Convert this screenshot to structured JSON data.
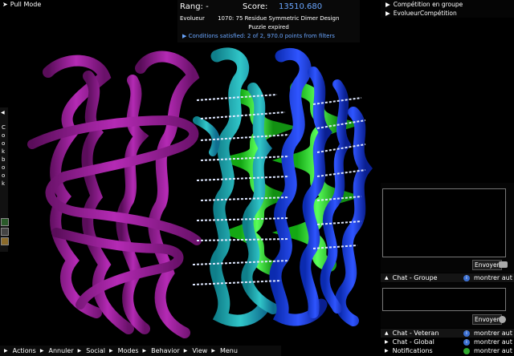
{
  "pull_mode": {
    "label": "Pull Mode"
  },
  "score_panel": {
    "rank_label": "Rang: -",
    "score_label": "Score:",
    "score_value": "13510.680",
    "player": "Evolueur",
    "puzzle_title": "1070: 75 Residue Symmetric Dimer Design",
    "status": "Puzzle expired",
    "conditions": "Conditions satisfied: 2 of 2, 970.0 points from filters",
    "score_color": "#6aa6ff"
  },
  "competition": {
    "items": [
      "Compétition en groupe",
      "EvolueurCompétition"
    ]
  },
  "cookbook": {
    "label": "Cookbook",
    "letters": [
      "C",
      "o",
      "o",
      "k",
      "b",
      "o",
      "o",
      "k"
    ]
  },
  "chat": {
    "send_label": "Envoyer",
    "show_label": "montrer aut",
    "tabs": [
      {
        "label": "Chat - Groupe"
      },
      {
        "label": "Chat - Veteran"
      },
      {
        "label": "Chat - Global"
      },
      {
        "label": "Notifications"
      }
    ]
  },
  "bottom_menu": {
    "items": [
      "Actions",
      "Annuler",
      "Social",
      "Modes",
      "Behavior",
      "View",
      "Menu"
    ]
  },
  "colors": {
    "chain_a": "#8a1a8a",
    "chain_b_teal": "#1aa6b0",
    "chain_b_blue": "#1a3fe0",
    "helix_green": "#2ee62e"
  }
}
